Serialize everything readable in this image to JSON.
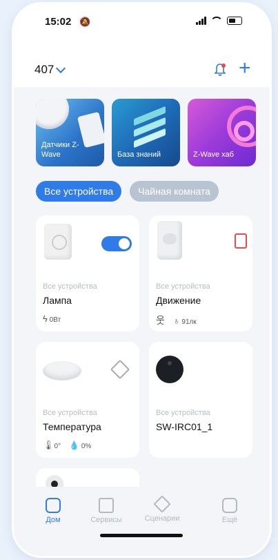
{
  "status": {
    "time": "15:02"
  },
  "header": {
    "home": "407"
  },
  "banners": [
    {
      "label": "Датчики Z-Wave"
    },
    {
      "label": "База знаний"
    },
    {
      "label": "Z-Wave хаб"
    }
  ],
  "chips": [
    {
      "label": "Все устройства",
      "active": true
    },
    {
      "label": "Чайная комната",
      "active": false
    }
  ],
  "devices": [
    {
      "room": "Все устройства",
      "name": "Лампа",
      "power": "0Вт",
      "on": true
    },
    {
      "room": "Все устройства",
      "name": "Движение",
      "lux": "91лк"
    },
    {
      "room": "Все устройства",
      "name": "Температура",
      "temp": "0°",
      "humidity": "0%"
    },
    {
      "room": "Все устройства",
      "name": "SW-IRC01_1"
    }
  ],
  "tabs": [
    {
      "label": "Дом",
      "active": true
    },
    {
      "label": "Сервисы"
    },
    {
      "label": "Сценарии"
    },
    {
      "label": "Ещё"
    }
  ],
  "colors": {
    "accent": "#2f7be8",
    "inactive_chip": "#b9c4d2",
    "alert": "#e74c4c"
  }
}
